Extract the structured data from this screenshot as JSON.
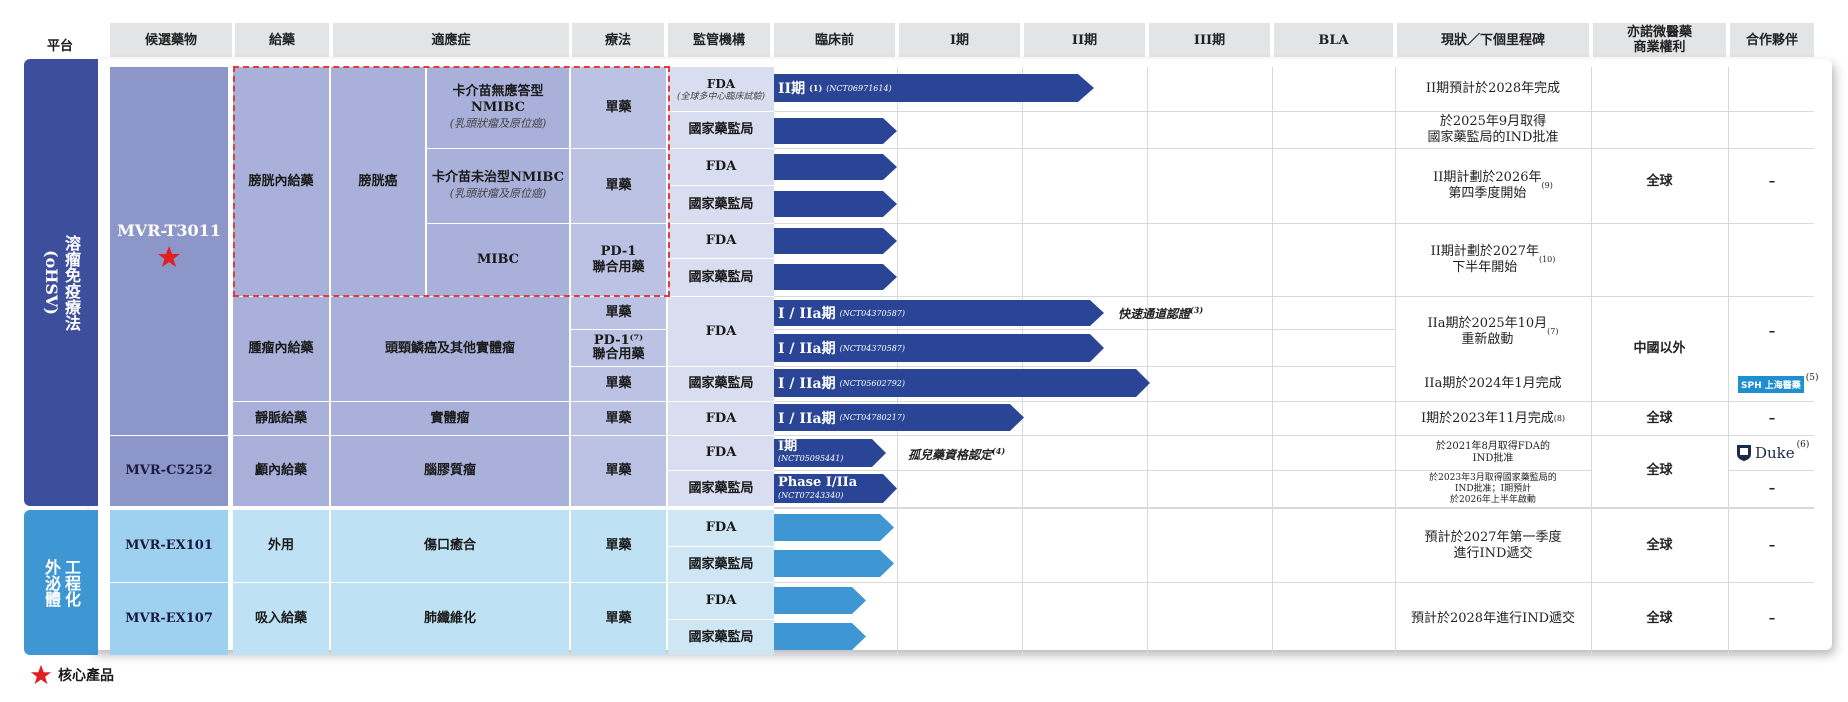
{
  "colors": {
    "platform_blue": "#3c4e9c",
    "platform_light": "#3e96d2",
    "col_dark": "#8c96c8",
    "col_mid": "#a9b0da",
    "col_light": "#bcc2e3",
    "reg_bg": "#d9ddf0",
    "light_col": "#9dd1ef",
    "light_reg": "#cfe6f5",
    "bar_dark": "#2b4596",
    "bar_light": "#3e96d2",
    "dashed": "#e03a3a",
    "star": "#e02020"
  },
  "header": {
    "platform": "平台",
    "candidate": "候選藥物",
    "route": "給藥",
    "indication": "適應症",
    "therapy": "療法",
    "regulator": "監管機構",
    "preclinical": "臨床前",
    "p1": "I期",
    "p2": "II期",
    "p3": "III期",
    "bla": "BLA",
    "status": "現狀／下個里程碑",
    "rights": "亦諾微醫藥\n商業權利",
    "partner": "合作夥伴"
  },
  "platforms": {
    "ohsv": "溶瘤免疫療法\n(oHSV)",
    "exo": "工程化\n外泌體"
  },
  "candidates": {
    "t3011": "MVR-T3011",
    "c5252": "MVR-C5252",
    "ex101": "MVR-EX101",
    "ex107": "MVR-EX107"
  },
  "routes": {
    "intravesical": "膀胱內給藥",
    "intratumoral": "腫瘤內給藥",
    "intravenous": "靜脈給藥",
    "intracranial": "顱內給藥",
    "topical": "外用",
    "inhaled": "吸入給藥"
  },
  "indications": {
    "bladder": "膀胱癌",
    "bcg_unresp": "卡介苗無應答型NMIBC",
    "bcg_unresp_sub": "(乳頭狀瘤及原位癌)",
    "bcg_naive": "卡介苗未治型NMIBC",
    "bcg_naive_sub": "(乳頭狀瘤及原位癌)",
    "mibc": "MIBC",
    "hn": "頭頸鱗癌及其他實體瘤",
    "solid": "實體瘤",
    "glioma": "腦膠質瘤",
    "wound": "傷口癒合",
    "fibrosis": "肺纖維化"
  },
  "therapy": {
    "mono": "單藥",
    "combo": "PD-1\n聯合用藥",
    "combo7": "PD-1⁽⁷⁾\n聯合用藥"
  },
  "regulators": {
    "fda": "FDA",
    "fda_global": "(全球多中心臨床試驗)",
    "nmpa": "國家藥監局"
  },
  "bars": {
    "b1_label": "II期",
    "b1_fn": "(1)",
    "b1_nct": "(NCT06971614)",
    "b5_label": "I / IIa期",
    "b5_nct": "(NCT04370587)",
    "b6_label": "I / IIa期",
    "b6_nct": "(NCT04370587)",
    "b7_label": "I / IIa期",
    "b7_nct": "(NCT05602792)",
    "b8_label": "I / IIa期",
    "b8_nct": "(NCT04780217)",
    "b9_label": "I期",
    "b9_nct": "(NCT05095441)",
    "b10_label": "Phase I/IIa",
    "b10_nct": "(NCT07243340)"
  },
  "notes": {
    "fast_track": "快速通道認證",
    "fast_track_fn": "(3)",
    "orphan": "孤兒藥資格認定",
    "orphan_fn": "(4)"
  },
  "status": {
    "s1": "II期預計於2028年完成",
    "s2": "於2025年9月取得\n國家藥監局的IND批准",
    "s3": "II期計劃於2026年\n第四季度開始",
    "s3_fn": "(9)",
    "s4": "II期計劃於2027年\n下半年開始",
    "s4_fn": "(10)",
    "s5": "IIa期於2025年10月\n重新啟動",
    "s5_fn": "(7)",
    "s6": "IIa期於2024年1月完成",
    "s7": "I期於2023年11月完成",
    "s7_fn": "(8)",
    "s8": "於2021年8月取得FDA的\nIND批准",
    "s9": "於2023年3月取得國家藥監局的\nIND批准；I期預計\n於2026年上半年啟動",
    "s10": "預計於2027年第一季度\n進行IND遞交",
    "s11": "預計於2028年進行IND遞交"
  },
  "rights": {
    "global": "全球",
    "ex_china": "中國以外"
  },
  "partners": {
    "dash": "–",
    "sph_label": "SPH 上海醫藥",
    "sph_fn": "(5)",
    "duke_label": "Duke",
    "duke_fn": "(6)"
  },
  "legend": {
    "core": "核心產品"
  }
}
